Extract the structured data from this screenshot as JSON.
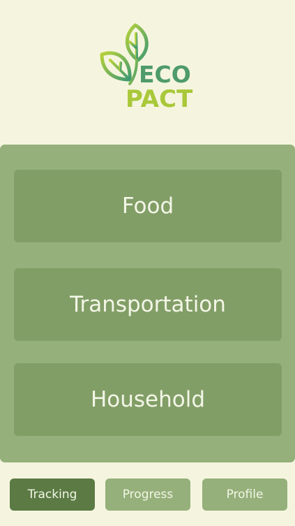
{
  "logo": {
    "line1": "ECO",
    "line2": "PACT",
    "icon": "leaf-icon"
  },
  "categories": [
    {
      "label": "Food"
    },
    {
      "label": "Transportation"
    },
    {
      "label": "Household"
    }
  ],
  "nav": {
    "tracking": "Tracking",
    "progress": "Progress",
    "profile": "Profile",
    "active": "Tracking"
  },
  "colors": {
    "background": "#f5f5df",
    "panel": "#95b07a",
    "card": "#829e67",
    "active_nav": "#5b7a44",
    "text_light": "#f3f6e7",
    "logo_green": "#4f9b69",
    "logo_lime": "#a9c83a"
  }
}
